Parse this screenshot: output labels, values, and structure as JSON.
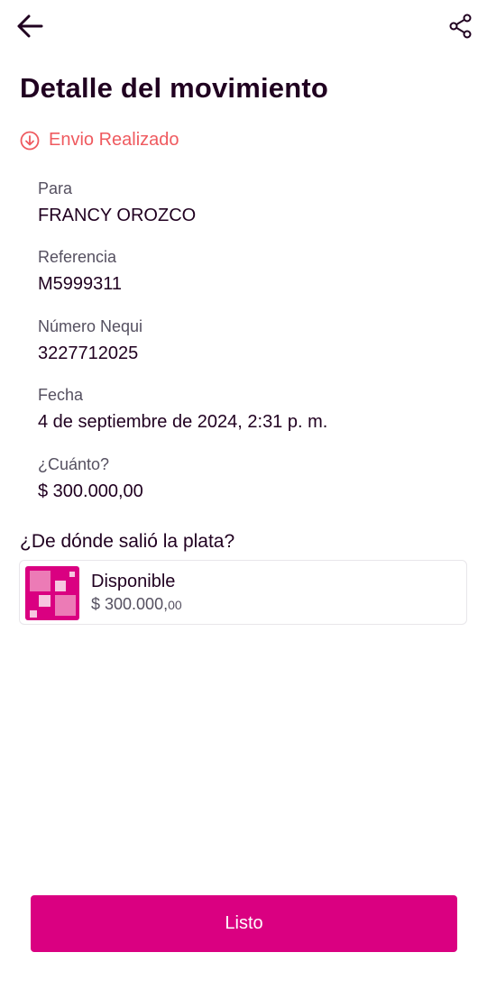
{
  "header": {
    "back_icon": "arrow-left-icon",
    "share_icon": "share-icon",
    "title": "Detalle del movimiento"
  },
  "status": {
    "icon": "arrow-down-circle-icon",
    "label": "Envio Realizado",
    "color": "#ef5a5f"
  },
  "details": [
    {
      "label": "Para",
      "value": "FRANCY OROZCO"
    },
    {
      "label": "Referencia",
      "value": "M5999311"
    },
    {
      "label": "Número Nequi",
      "value": "3227712025"
    },
    {
      "label": "Fecha",
      "value": "4 de septiembre de 2024, 2:31 p. m."
    },
    {
      "label": "¿Cuánto?",
      "value": "$ 300.000,00"
    }
  ],
  "source": {
    "question": "¿De dónde salió la plata?",
    "account_name": "Disponible",
    "amount_main": "$ 300.000,",
    "amount_cents": "00",
    "icon": "wallet-squares-icon"
  },
  "footer": {
    "button_label": "Listo"
  },
  "colors": {
    "brand": "#da0081",
    "text": "#200020",
    "muted": "#555060"
  }
}
